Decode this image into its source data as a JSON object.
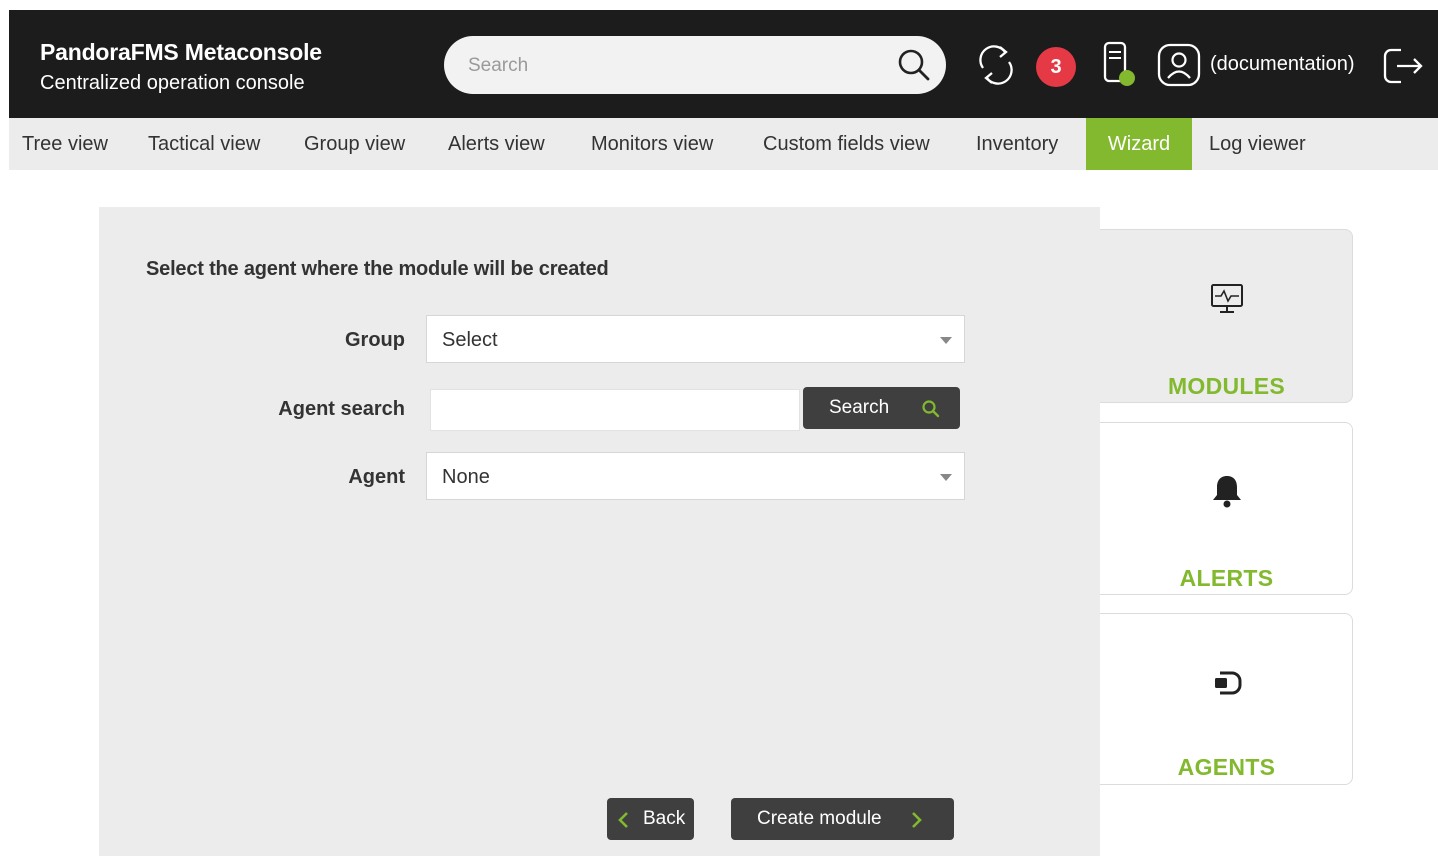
{
  "header": {
    "title": "PandoraFMS Metaconsole",
    "subtitle": "Centralized operation console",
    "search_placeholder": "Search",
    "notification_count": "3",
    "user_label": "(documentation)",
    "icons": [
      "search-icon",
      "refresh-icon",
      "server-status-icon",
      "user-icon",
      "logout-icon"
    ]
  },
  "nav": {
    "items": [
      {
        "label": "Tree view"
      },
      {
        "label": "Tactical view"
      },
      {
        "label": "Group view"
      },
      {
        "label": "Alerts view"
      },
      {
        "label": "Monitors view"
      },
      {
        "label": "Custom fields view"
      },
      {
        "label": "Inventory"
      },
      {
        "label": "Wizard",
        "active": true
      },
      {
        "label": "Log viewer"
      }
    ]
  },
  "form": {
    "title": "Select the agent where the module will be created",
    "group_label": "Group",
    "group_value": "Select",
    "agent_search_label": "Agent search",
    "agent_search_value": "",
    "search_button": "Search",
    "agent_label": "Agent",
    "agent_value": "None",
    "back_button": "Back",
    "create_button": "Create module"
  },
  "cards": [
    {
      "label": "MODULES",
      "icon": "monitor-icon",
      "selected": true
    },
    {
      "label": "ALERTS",
      "icon": "bell-icon"
    },
    {
      "label": "AGENTS",
      "icon": "agent-icon"
    }
  ],
  "colors": {
    "accent": "#82b92e",
    "header_bg": "#1c1c1c",
    "badge": "#e63946",
    "button": "#3f3f3f"
  }
}
